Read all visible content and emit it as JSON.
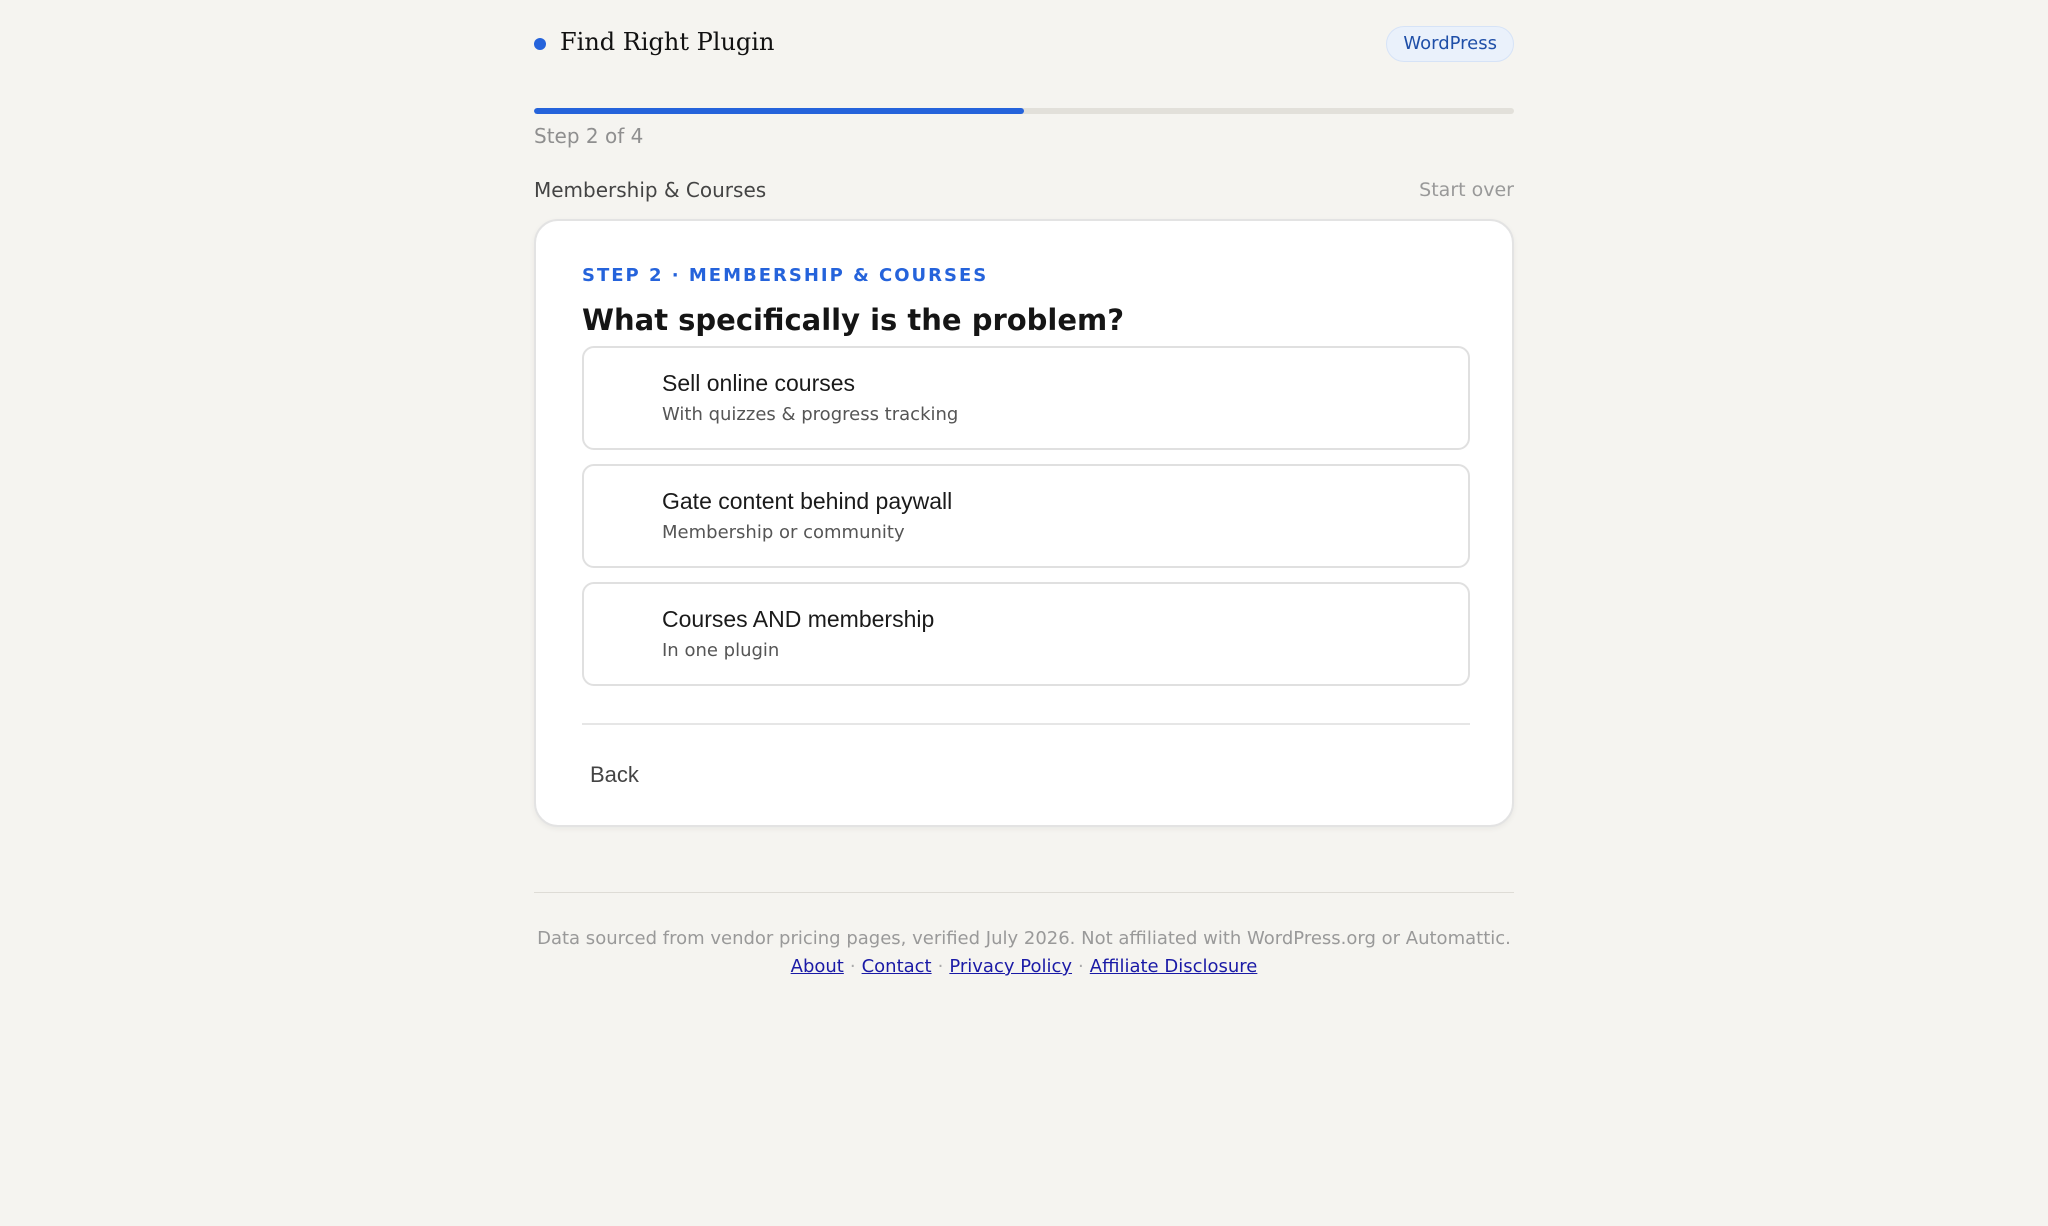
{
  "header": {
    "brand_name": "Find Right Plugin",
    "platform_badge": "WordPress"
  },
  "progress": {
    "current_step": 2,
    "total_steps": 4,
    "fraction": 0.5,
    "label": "Step 2 of 4"
  },
  "context": {
    "category": "Membership & Courses",
    "start_over": "Start over"
  },
  "card": {
    "eyebrow": "STEP 2 · MEMBERSHIP & COURSES",
    "question": "What specifically is the problem?",
    "options": [
      {
        "title": "Sell online courses",
        "subtitle": "With quizzes & progress tracking"
      },
      {
        "title": "Gate content behind paywall",
        "subtitle": "Membership or community"
      },
      {
        "title": "Courses AND membership",
        "subtitle": "In one plugin"
      }
    ],
    "back_label": "Back"
  },
  "footer": {
    "note": "Data sourced from vendor pricing pages, verified July 2026. Not affiliated with WordPress.org or Automattic.",
    "links": [
      "About",
      "Contact",
      "Privacy Policy",
      "Affiliate Disclosure"
    ],
    "separator": "·"
  },
  "colors": {
    "accent": "#2563db",
    "background": "#f5f4f0",
    "card": "#ffffff",
    "link": "#1a1aa6"
  }
}
